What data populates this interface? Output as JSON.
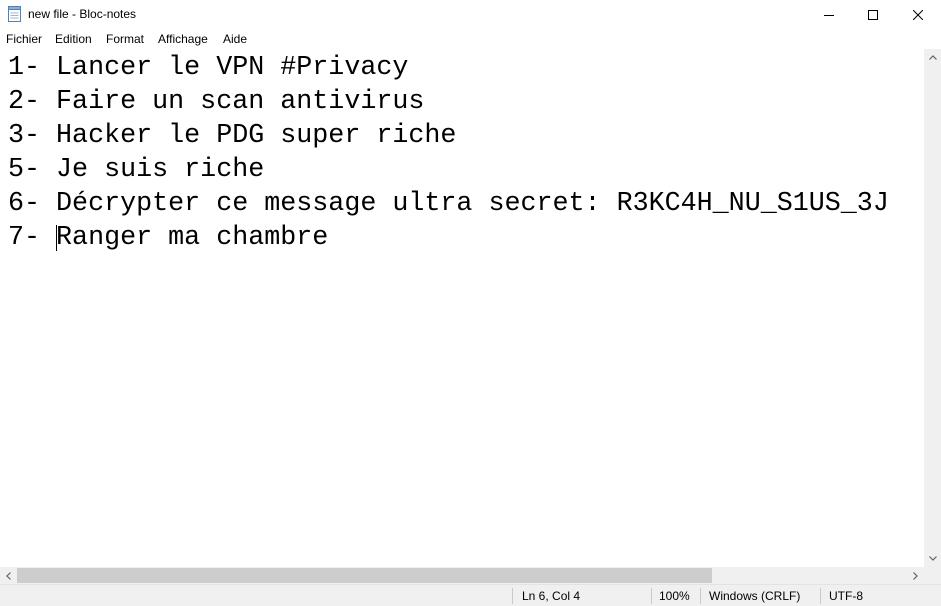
{
  "window": {
    "title": "new file - Bloc-notes",
    "icon": "notepad-icon"
  },
  "menu": {
    "items": [
      {
        "label": "Fichier"
      },
      {
        "label": "Edition"
      },
      {
        "label": "Format"
      },
      {
        "label": "Affichage"
      },
      {
        "label": "Aide"
      }
    ]
  },
  "editor": {
    "lines": [
      "1- Lancer le VPN #Privacy",
      "2- Faire un scan antivirus",
      "3- Hacker le PDG super riche",
      "5- Je suis riche",
      "6- Décrypter ce message ultra secret: R3KC4H_NU_S1US_3J",
      "7- Ranger ma chambre"
    ]
  },
  "statusbar": {
    "position": "Ln 6, Col 4",
    "zoom": "100%",
    "line_ending": "Windows (CRLF)",
    "encoding": "UTF-8"
  }
}
